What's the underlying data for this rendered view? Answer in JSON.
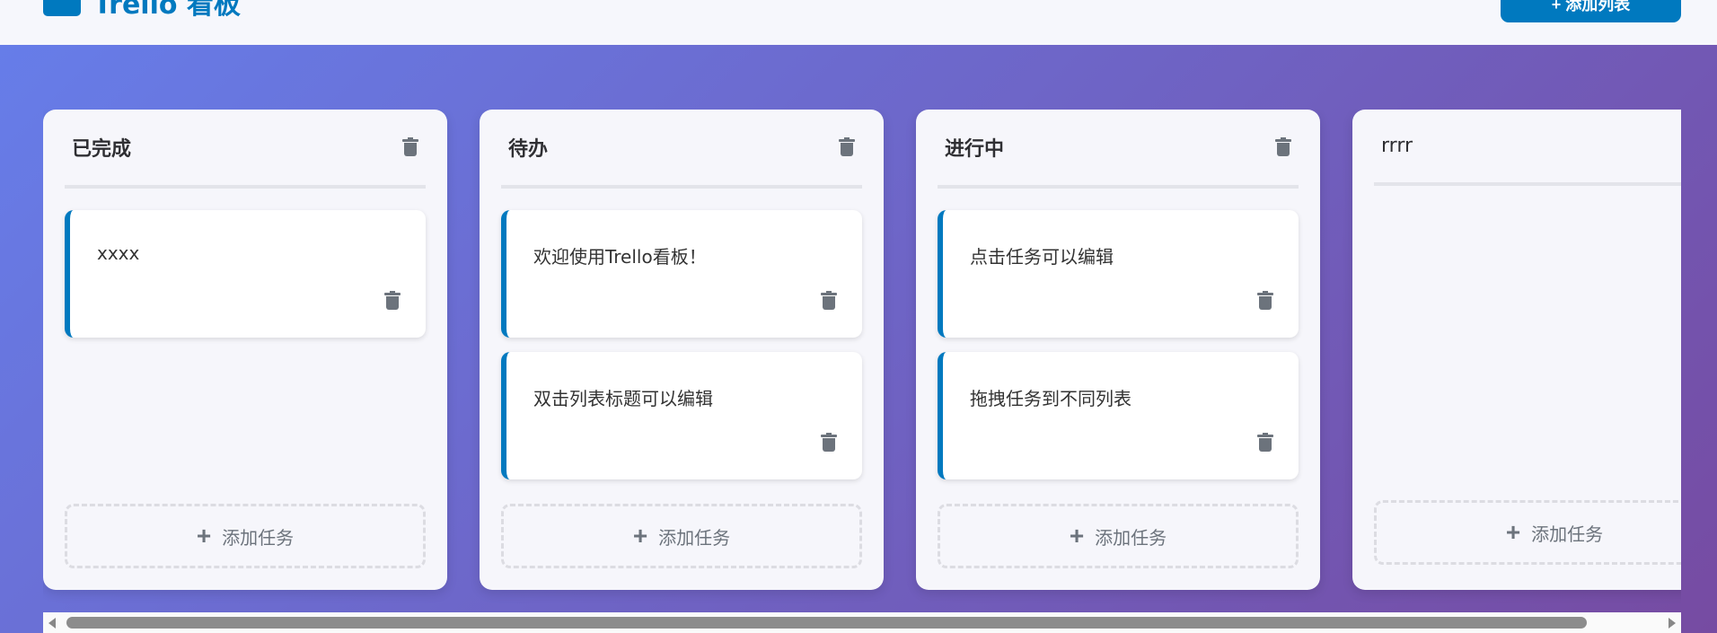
{
  "header": {
    "title": "Trello 看板",
    "add_list_label": "+ 添加列表"
  },
  "lists": [
    {
      "title": "已完成",
      "cards": [
        "xxxx"
      ]
    },
    {
      "title": "待办",
      "cards": [
        "欢迎使用Trello看板！",
        "双击列表标题可以编辑"
      ]
    },
    {
      "title": "进行中",
      "cards": [
        "点击任务可以编辑",
        "拖拽任务到不同列表"
      ]
    },
    {
      "title": "rrrr",
      "cards": []
    }
  ],
  "add_task_label": "添加任务",
  "colors": {
    "accent": "#0079bf",
    "gradient_start": "#667eea",
    "gradient_end": "#764ba2"
  }
}
